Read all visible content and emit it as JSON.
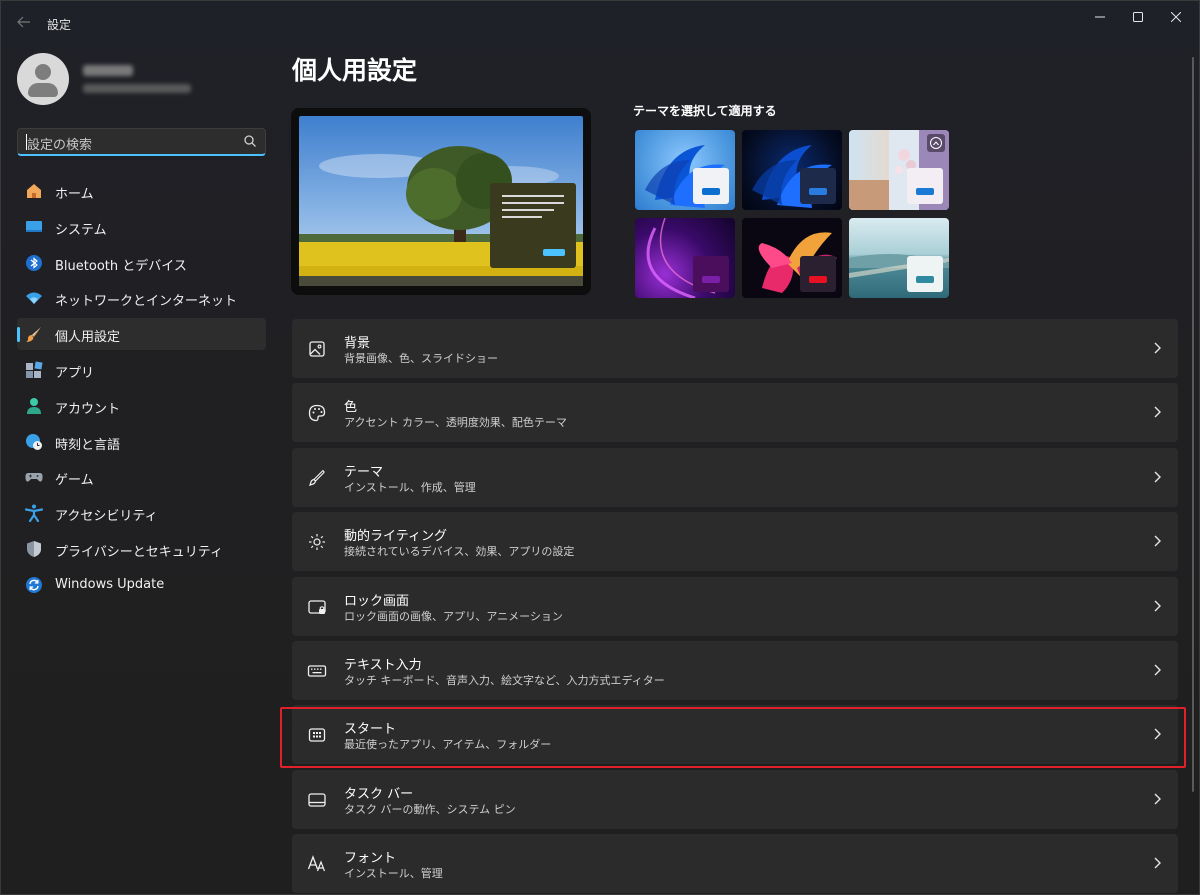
{
  "window": {
    "title": "設定"
  },
  "user": {
    "name": "",
    "email": ""
  },
  "search": {
    "placeholder": "設定の検索"
  },
  "sidebar": {
    "items": [
      {
        "label": "ホーム",
        "icon": "home-icon"
      },
      {
        "label": "システム",
        "icon": "system-icon"
      },
      {
        "label": "Bluetooth とデバイス",
        "icon": "bluetooth-icon"
      },
      {
        "label": "ネットワークとインターネット",
        "icon": "wifi-icon"
      },
      {
        "label": "個人用設定",
        "icon": "paintbrush-icon",
        "active": true
      },
      {
        "label": "アプリ",
        "icon": "apps-icon"
      },
      {
        "label": "アカウント",
        "icon": "account-icon"
      },
      {
        "label": "時刻と言語",
        "icon": "globe-clock-icon"
      },
      {
        "label": "ゲーム",
        "icon": "gamepad-icon"
      },
      {
        "label": "アクセシビリティ",
        "icon": "accessibility-icon"
      },
      {
        "label": "プライバシーとセキュリティ",
        "icon": "shield-icon"
      },
      {
        "label": "Windows Update",
        "icon": "update-icon"
      }
    ]
  },
  "main": {
    "title": "個人用設定",
    "theme_heading": "テーマを選択して適用する",
    "colors": {
      "accent": "#4cc2ff",
      "highlight": "#e0202a",
      "card": "#2b2b2b"
    },
    "rows": [
      {
        "title": "背景",
        "subtitle": "背景画像、色、スライドショー",
        "icon": "image-icon"
      },
      {
        "title": "色",
        "subtitle": "アクセント カラー、透明度効果、配色テーマ",
        "icon": "palette-icon"
      },
      {
        "title": "テーマ",
        "subtitle": "インストール、作成、管理",
        "icon": "brush-icon"
      },
      {
        "title": "動的ライティング",
        "subtitle": "接続されているデバイス、効果、アプリの設定",
        "icon": "lighting-icon"
      },
      {
        "title": "ロック画面",
        "subtitle": "ロック画面の画像、アプリ、アニメーション",
        "icon": "lock-screen-icon"
      },
      {
        "title": "テキスト入力",
        "subtitle": "タッチ キーボード、音声入力、絵文字など、入力方式エディター",
        "icon": "keyboard-icon"
      },
      {
        "title": "スタート",
        "subtitle": "最近使ったアプリ、アイテム、フォルダー",
        "icon": "start-icon",
        "highlighted": true
      },
      {
        "title": "タスク バー",
        "subtitle": "タスク バーの動作、システム ピン",
        "icon": "taskbar-icon"
      },
      {
        "title": "フォント",
        "subtitle": "インストール、管理",
        "icon": "font-icon"
      }
    ]
  }
}
